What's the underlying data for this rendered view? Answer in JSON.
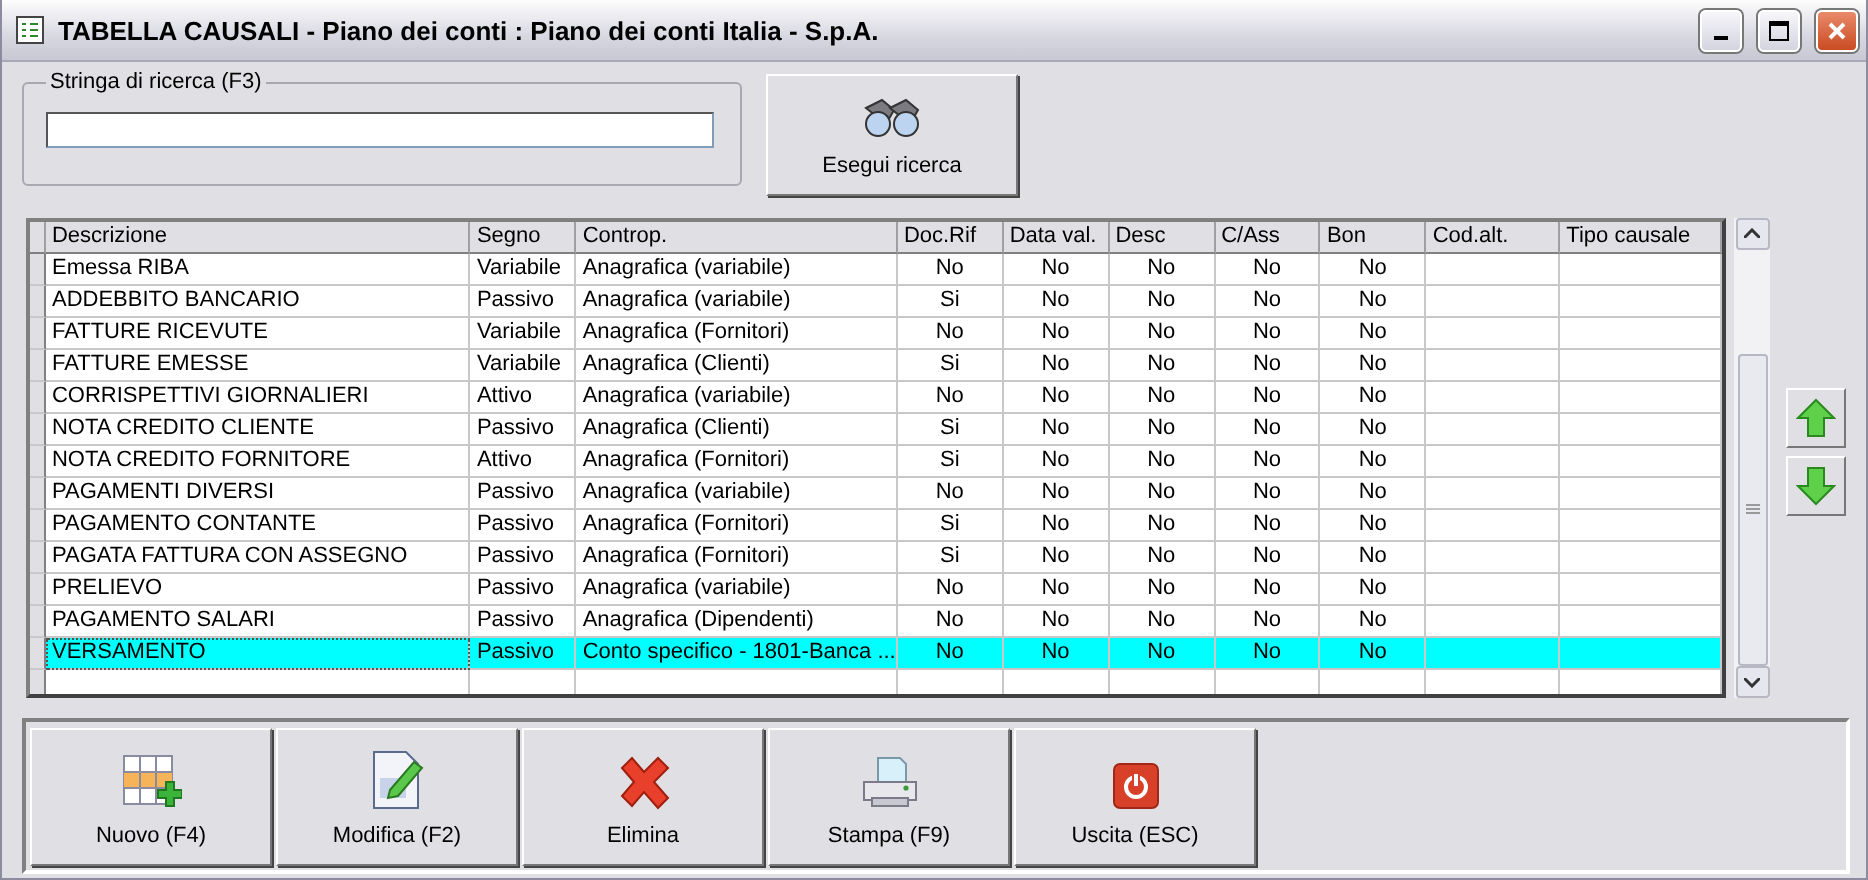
{
  "window": {
    "title": "TABELLA CAUSALI - Piano dei conti : Piano dei conti Italia - S.p.A."
  },
  "search": {
    "label": "Stringa di ricerca (F3)",
    "button": "Esegui ricerca"
  },
  "table": {
    "columns": [
      "Descrizione",
      "Segno",
      "Controp.",
      "Doc.Rif",
      "Data val.",
      "Desc",
      "C/Ass",
      "Bon",
      "Cod.alt.",
      "Tipo causale"
    ],
    "rows": [
      {
        "cells": [
          "Emessa RIBA",
          "Variabile",
          "Anagrafica (variabile)",
          "No",
          "No",
          "No",
          "No",
          "No",
          "",
          ""
        ],
        "selected": false
      },
      {
        "cells": [
          "ADDEBBITO BANCARIO",
          "Passivo",
          "Anagrafica (variabile)",
          "Si",
          "No",
          "No",
          "No",
          "No",
          "",
          ""
        ],
        "selected": false
      },
      {
        "cells": [
          "FATTURE RICEVUTE",
          "Variabile",
          "Anagrafica (Fornitori)",
          "No",
          "No",
          "No",
          "No",
          "No",
          "",
          ""
        ],
        "selected": false
      },
      {
        "cells": [
          "FATTURE EMESSE",
          "Variabile",
          "Anagrafica (Clienti)",
          "Si",
          "No",
          "No",
          "No",
          "No",
          "",
          ""
        ],
        "selected": false
      },
      {
        "cells": [
          "CORRISPETTIVI GIORNALIERI",
          "Attivo",
          "Anagrafica (variabile)",
          "No",
          "No",
          "No",
          "No",
          "No",
          "",
          ""
        ],
        "selected": false
      },
      {
        "cells": [
          "NOTA CREDITO CLIENTE",
          "Passivo",
          "Anagrafica (Clienti)",
          "Si",
          "No",
          "No",
          "No",
          "No",
          "",
          ""
        ],
        "selected": false
      },
      {
        "cells": [
          "NOTA CREDITO FORNITORE",
          "Attivo",
          "Anagrafica (Fornitori)",
          "Si",
          "No",
          "No",
          "No",
          "No",
          "",
          ""
        ],
        "selected": false
      },
      {
        "cells": [
          "PAGAMENTI DIVERSI",
          "Passivo",
          "Anagrafica (variabile)",
          "No",
          "No",
          "No",
          "No",
          "No",
          "",
          ""
        ],
        "selected": false
      },
      {
        "cells": [
          "PAGAMENTO CONTANTE",
          "Passivo",
          "Anagrafica (Fornitori)",
          "Si",
          "No",
          "No",
          "No",
          "No",
          "",
          ""
        ],
        "selected": false
      },
      {
        "cells": [
          "PAGATA FATTURA CON ASSEGNO",
          "Passivo",
          "Anagrafica (Fornitori)",
          "Si",
          "No",
          "No",
          "No",
          "No",
          "",
          ""
        ],
        "selected": false
      },
      {
        "cells": [
          "PRELIEVO",
          "Passivo",
          "Anagrafica (variabile)",
          "No",
          "No",
          "No",
          "No",
          "No",
          "",
          ""
        ],
        "selected": false
      },
      {
        "cells": [
          "PAGAMENTO SALARI",
          "Passivo",
          "Anagrafica (Dipendenti)",
          "No",
          "No",
          "No",
          "No",
          "No",
          "",
          ""
        ],
        "selected": false
      },
      {
        "cells": [
          "VERSAMENTO",
          "Passivo",
          "Conto specifico - 1801-Banca ...",
          "No",
          "No",
          "No",
          "No",
          "No",
          "",
          ""
        ],
        "selected": true
      }
    ]
  },
  "toolbar": [
    {
      "kind": "new",
      "label": "Nuovo (F4)"
    },
    {
      "kind": "edit",
      "label": "Modifica (F2)"
    },
    {
      "kind": "delete",
      "label": "Elimina"
    },
    {
      "kind": "print",
      "label": "Stampa (F9)"
    },
    {
      "kind": "exit",
      "label": "Uscita (ESC)"
    }
  ]
}
